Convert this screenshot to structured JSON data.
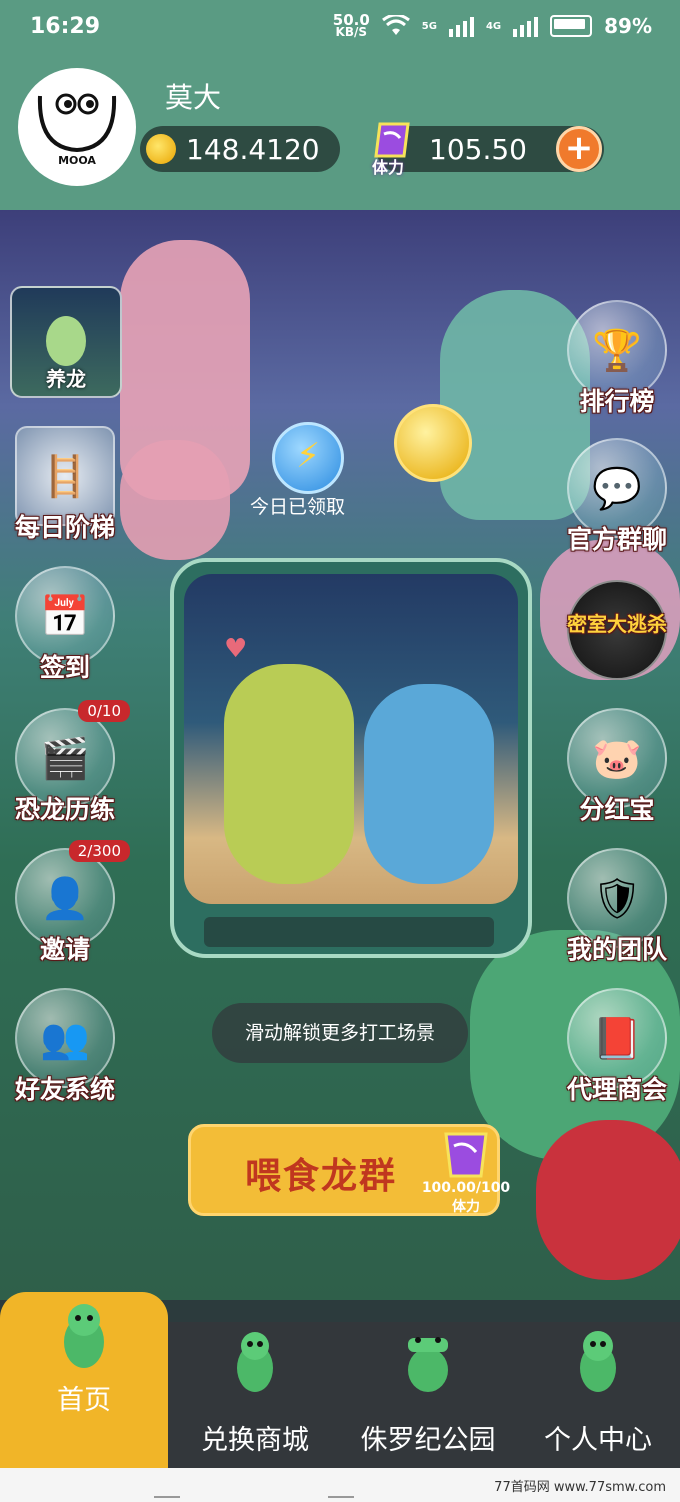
{
  "status": {
    "time": "16:29",
    "speed": "50.0",
    "speed_unit": "KB/S",
    "net1": "5G",
    "net2": "4G",
    "battery": "89%"
  },
  "user": {
    "name": "莫大",
    "avatar_text": "MOOA",
    "coins": "148.4120",
    "stamina": "105.50",
    "stamina_label": "体力"
  },
  "side_left": [
    {
      "label": "养龙"
    },
    {
      "label": "每日阶梯"
    },
    {
      "label": "签到"
    },
    {
      "label": "恐龙历练",
      "badge": "0/10"
    },
    {
      "label": "邀请",
      "badge": "2/300"
    },
    {
      "label": "好友系统"
    }
  ],
  "side_right": [
    {
      "label": "排行榜"
    },
    {
      "label": "官方群聊"
    },
    {
      "label": "密室大逃杀"
    },
    {
      "label": "分红宝"
    },
    {
      "label": "我的团队"
    },
    {
      "label": "代理商会"
    }
  ],
  "center": {
    "claimed": "今日已领取",
    "toast": "滑动解锁更多打工场景"
  },
  "feed": {
    "label": "喂食龙群",
    "stamina": "100.00/100",
    "unit": "体力"
  },
  "tabs": [
    {
      "label": "首页",
      "active": true
    },
    {
      "label": "兑换商城"
    },
    {
      "label": "侏罗纪公园"
    },
    {
      "label": "个人中心"
    }
  ],
  "watermark": "77首码网 www.77smw.com",
  "colors": {
    "header": "#5a9b83",
    "accent": "#f1b528",
    "badge": "#c8282c",
    "feed_text": "#c0371f"
  }
}
